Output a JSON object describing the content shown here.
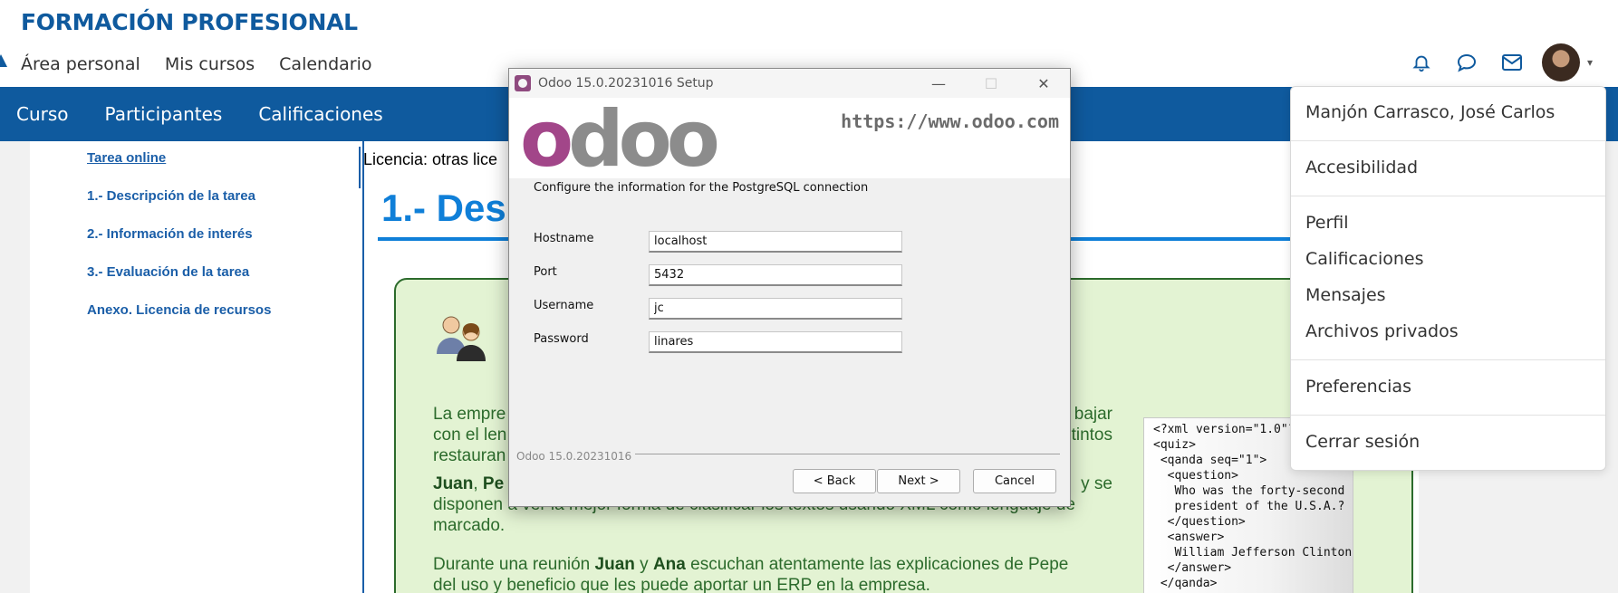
{
  "site": {
    "title": "FORMACIÓN PROFESIONAL"
  },
  "topnav": [
    "Área personal",
    "Mis cursos",
    "Calendario"
  ],
  "subnav": [
    "Curso",
    "Participantes",
    "Calificaciones"
  ],
  "toc": [
    "Tarea online",
    "1.- Descripción de la tarea",
    "2.- Información de interés",
    "3.- Evaluación de la tarea",
    "Anexo. Licencia de recursos"
  ],
  "content": {
    "licencia_prefix": "Licencia: otras lice",
    "heading": "1.- Des",
    "p1": [
      "La empre",
      "bajar",
      "con el len",
      "stintos",
      "restauran"
    ],
    "p2_names": [
      "Juan",
      "Pe"
    ],
    "p2_end": "y se",
    "p2_line2": "disponen a ver la mejor forma de clasificar los textos usando XML como lenguaje de",
    "p2_line3": "marcado.",
    "p3": {
      "a": "Durante una reunión ",
      "juan": "Juan",
      "y": " y ",
      "ana": "Ana",
      "b": " escuchan atentamente las explicaciones de Pepe",
      "line2": "del uso y beneficio que les puede aportar un ERP en la empresa."
    },
    "xml_code": "<?xml version=\"1.0\"?>\n<quiz>\n <qanda seq=\"1\">\n  <question>\n   Who was the forty-second\n   president of the U.S.A.?\n  </question>\n  <answer>\n   William Jefferson Clinton\n  </answer>\n </qanda>"
  },
  "dialog": {
    "title": "Odoo 15.0.20231016 Setup",
    "logo": {
      "first": "o",
      "rest": "doo"
    },
    "url": "https://www.odoo.com",
    "subtitle": "Configure the information for the PostgreSQL connection",
    "fields": [
      {
        "label": "Hostname",
        "value": "localhost"
      },
      {
        "label": "Port",
        "value": "5432"
      },
      {
        "label": "Username",
        "value": "jc"
      },
      {
        "label": "Password",
        "value": "linares"
      }
    ],
    "version": "Odoo 15.0.20231016",
    "buttons": {
      "back": "< Back",
      "next": "Next >",
      "cancel": "Cancel"
    }
  },
  "user_menu": {
    "name": "Manjón Carrasco, José Carlos",
    "items": [
      "Accesibilidad",
      "Perfil",
      "Calificaciones",
      "Mensajes",
      "Archivos privados",
      "Preferencias",
      "Cerrar sesión"
    ]
  },
  "icons": {
    "header": [
      "bell-icon",
      "chat-icon",
      "mail-icon",
      "avatar",
      "chevron-down-icon"
    ],
    "content": [
      "people-icon"
    ]
  },
  "colors": {
    "brand_blue": "#0f5a9e",
    "link_blue": "#1a5ea8",
    "heading_blue": "#0f7fd8",
    "green_text": "#2c6b2c",
    "green_bg": "#e3f3d3",
    "odoo_purple": "#a24689"
  }
}
